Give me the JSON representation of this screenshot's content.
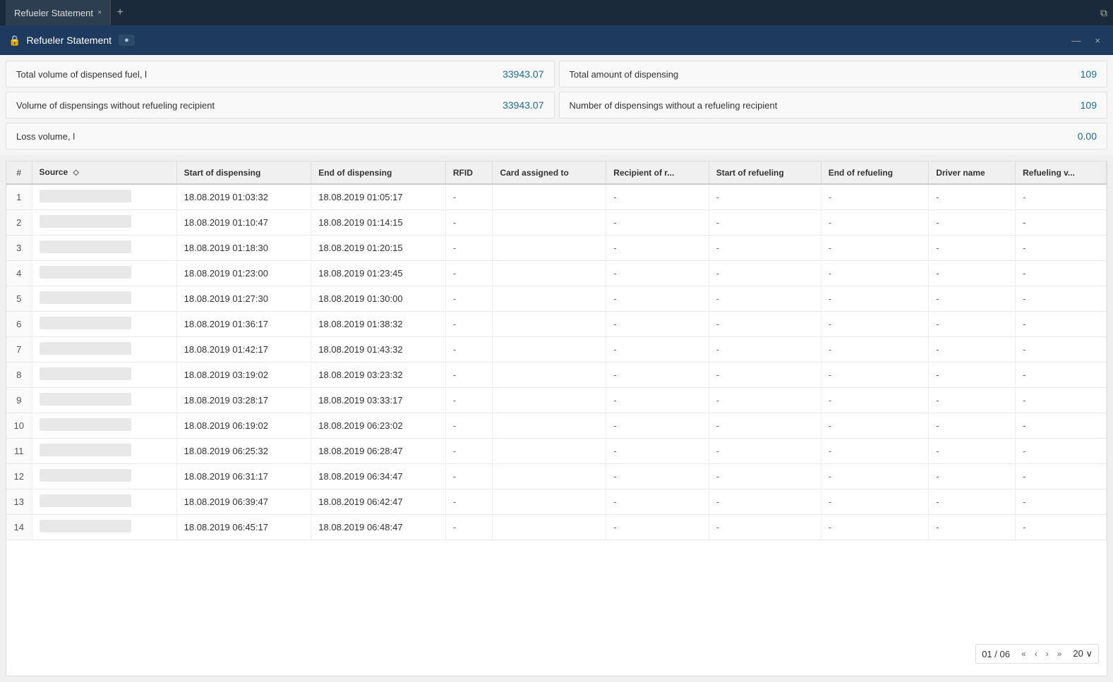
{
  "title_bar": {
    "tab_label": "Refueler Statement",
    "close_label": "×",
    "add_tab_label": "+",
    "window_icon": "⧉"
  },
  "app_bar": {
    "title": "Refueler Statement",
    "lock_icon": "🔒",
    "minimize_icon": "—",
    "close_icon": "×"
  },
  "summary": {
    "cards": [
      {
        "label": "Total volume of dispensed fuel, l",
        "value": "33943.07"
      },
      {
        "label": "Total amount of dispensing",
        "value": "109"
      },
      {
        "label": "Volume of dispensings without refueling recipient",
        "value": "33943.07"
      },
      {
        "label": "Number of dispensings without a refueling recipient",
        "value": "109"
      },
      {
        "label": "Loss volume, l",
        "value": "0.00",
        "fullWidth": true
      }
    ]
  },
  "table": {
    "columns": [
      {
        "id": "row_num",
        "label": "#"
      },
      {
        "id": "source",
        "label": "Source",
        "sortable": true
      },
      {
        "id": "start_dispensing",
        "label": "Start of dispensing"
      },
      {
        "id": "end_dispensing",
        "label": "End of dispensing"
      },
      {
        "id": "rfid",
        "label": "RFID"
      },
      {
        "id": "card_assigned",
        "label": "Card assigned to"
      },
      {
        "id": "recipient",
        "label": "Recipient of r..."
      },
      {
        "id": "start_refueling",
        "label": "Start of refueling"
      },
      {
        "id": "end_refueling",
        "label": "End of refueling"
      },
      {
        "id": "driver_name",
        "label": "Driver name"
      },
      {
        "id": "refueling_v",
        "label": "Refueling v..."
      }
    ],
    "rows": [
      {
        "num": 1,
        "start": "18.08.2019 01:03:32",
        "end": "18.08.2019 01:05:17",
        "rfid": "-",
        "card": "",
        "recipient": "-",
        "start_ref": "-",
        "end_ref": "-",
        "driver": "-",
        "ref_v": "-"
      },
      {
        "num": 2,
        "start": "18.08.2019 01:10:47",
        "end": "18.08.2019 01:14:15",
        "rfid": "-",
        "card": "",
        "recipient": "-",
        "start_ref": "-",
        "end_ref": "-",
        "driver": "-",
        "ref_v": "-"
      },
      {
        "num": 3,
        "start": "18.08.2019 01:18:30",
        "end": "18.08.2019 01:20:15",
        "rfid": "-",
        "card": "",
        "recipient": "-",
        "start_ref": "-",
        "end_ref": "-",
        "driver": "-",
        "ref_v": "-"
      },
      {
        "num": 4,
        "start": "18.08.2019 01:23:00",
        "end": "18.08.2019 01:23:45",
        "rfid": "-",
        "card": "",
        "recipient": "-",
        "start_ref": "-",
        "end_ref": "-",
        "driver": "-",
        "ref_v": "-"
      },
      {
        "num": 5,
        "start": "18.08.2019 01:27:30",
        "end": "18.08.2019 01:30:00",
        "rfid": "-",
        "card": "",
        "recipient": "-",
        "start_ref": "-",
        "end_ref": "-",
        "driver": "-",
        "ref_v": "-"
      },
      {
        "num": 6,
        "start": "18.08.2019 01:36:17",
        "end": "18.08.2019 01:38:32",
        "rfid": "-",
        "card": "",
        "recipient": "-",
        "start_ref": "-",
        "end_ref": "-",
        "driver": "-",
        "ref_v": "-"
      },
      {
        "num": 7,
        "start": "18.08.2019 01:42:17",
        "end": "18.08.2019 01:43:32",
        "rfid": "-",
        "card": "",
        "recipient": "-",
        "start_ref": "-",
        "end_ref": "-",
        "driver": "-",
        "ref_v": "-"
      },
      {
        "num": 8,
        "start": "18.08.2019 03:19:02",
        "end": "18.08.2019 03:23:32",
        "rfid": "-",
        "card": "",
        "recipient": "-",
        "start_ref": "-",
        "end_ref": "-",
        "driver": "-",
        "ref_v": "-"
      },
      {
        "num": 9,
        "start": "18.08.2019 03:28:17",
        "end": "18.08.2019 03:33:17",
        "rfid": "-",
        "card": "",
        "recipient": "-",
        "start_ref": "-",
        "end_ref": "-",
        "driver": "-",
        "ref_v": "-"
      },
      {
        "num": 10,
        "start": "18.08.2019 06:19:02",
        "end": "18.08.2019 06:23:02",
        "rfid": "-",
        "card": "",
        "recipient": "-",
        "start_ref": "-",
        "end_ref": "-",
        "driver": "-",
        "ref_v": "-"
      },
      {
        "num": 11,
        "start": "18.08.2019 06:25:32",
        "end": "18.08.2019 06:28:47",
        "rfid": "-",
        "card": "",
        "recipient": "-",
        "start_ref": "-",
        "end_ref": "-",
        "driver": "-",
        "ref_v": "-"
      },
      {
        "num": 12,
        "start": "18.08.2019 06:31:17",
        "end": "18.08.2019 06:34:47",
        "rfid": "-",
        "card": "",
        "recipient": "-",
        "start_ref": "-",
        "end_ref": "-",
        "driver": "-",
        "ref_v": "-"
      },
      {
        "num": 13,
        "start": "18.08.2019 06:39:47",
        "end": "18.08.2019 06:42:47",
        "rfid": "-",
        "card": "",
        "recipient": "-",
        "start_ref": "-",
        "end_ref": "-",
        "driver": "-",
        "ref_v": "-"
      },
      {
        "num": 14,
        "start": "18.08.2019 06:45:17",
        "end": "18.08.2019 06:48:47",
        "rfid": "-",
        "card": "",
        "recipient": "-",
        "start_ref": "-",
        "end_ref": "-",
        "driver": "-",
        "ref_v": "-"
      }
    ]
  },
  "pagination": {
    "current_page": "01",
    "total_pages": "06",
    "page_size": "20",
    "first_label": "«",
    "prev_label": "‹",
    "next_label": "›",
    "last_label": "»",
    "of_label": "/",
    "dropdown_icon": "∨"
  }
}
